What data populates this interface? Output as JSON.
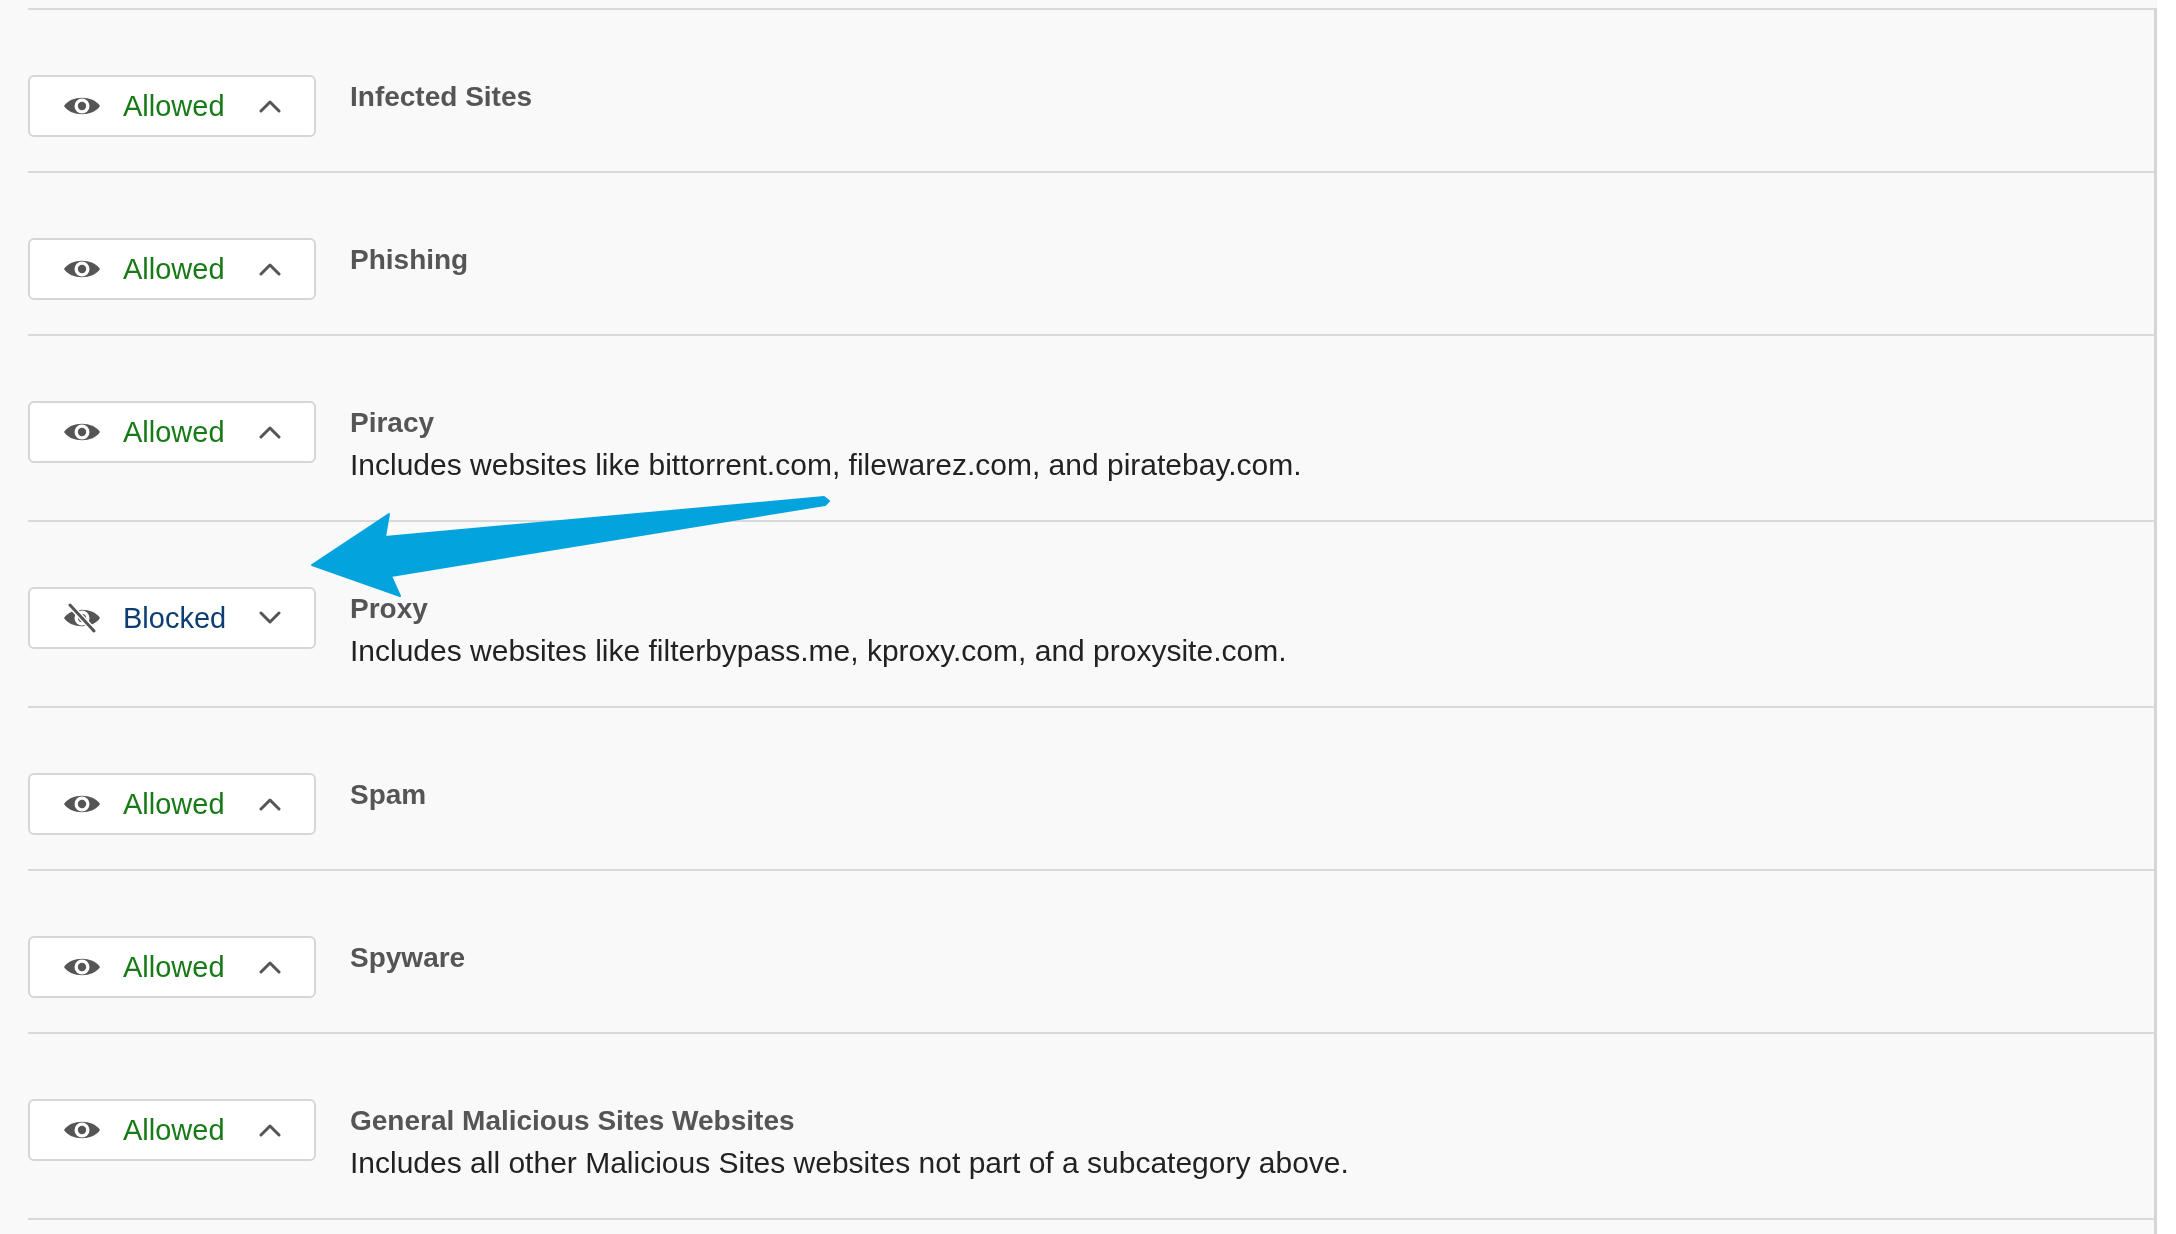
{
  "categories": [
    {
      "title": "Infected Sites",
      "status": "Allowed",
      "blocked": false,
      "pointed_out": false
    },
    {
      "title": "Phishing",
      "status": "Allowed",
      "blocked": false,
      "pointed_out": false
    },
    {
      "title": "Piracy",
      "description": "Includes websites like bittorrent.com, filewarez.com, and piratebay.com.",
      "status": "Allowed",
      "blocked": false,
      "pointed_out": false
    },
    {
      "title": "Proxy",
      "description": "Includes websites like filterbypass.me, kproxy.com, and proxysite.com.",
      "status": "Blocked",
      "blocked": true,
      "pointed_out": true
    },
    {
      "title": "Spam",
      "status": "Allowed",
      "blocked": false,
      "pointed_out": false
    },
    {
      "title": "Spyware",
      "status": "Allowed",
      "blocked": false,
      "pointed_out": false
    },
    {
      "title": "General Malicious Sites Websites",
      "description": "Includes all other Malicious Sites websites not part of a subcategory above.",
      "status": "Allowed",
      "blocked": false,
      "pointed_out": false
    }
  ]
}
